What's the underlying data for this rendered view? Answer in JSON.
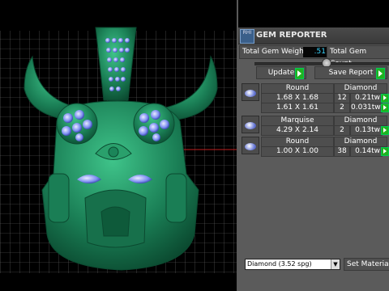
{
  "panel": {
    "title": "GEM REPORTER",
    "logo_text": "RHI",
    "total_gem_weight_label": "Total Gem Weight",
    "total_gem_weight_value": ".51",
    "total_gem_count_label": "Total Gem Count",
    "update_label": "Update",
    "save_report_label": "Save Report",
    "gems": [
      {
        "shape": "Round",
        "material": "Diamond",
        "sizes": [
          {
            "size": "1.68 X 1.68",
            "count": "12",
            "weight": "0.21tw"
          },
          {
            "size": "1.61 X 1.61",
            "count": "2",
            "weight": "0.031tw"
          }
        ]
      },
      {
        "shape": "Marquise",
        "material": "Diamond",
        "sizes": [
          {
            "size": "4.29 X 2.14",
            "count": "2",
            "weight": "0.13tw"
          }
        ]
      },
      {
        "shape": "Round",
        "material": "Diamond",
        "sizes": [
          {
            "size": "1.00 X 1.00",
            "count": "38",
            "weight": "0.14tw"
          }
        ]
      }
    ],
    "material_select": "Diamond",
    "material_select_spg": "(3.52 spg)",
    "set_material_label": "Set Material"
  },
  "colors": {
    "model": "#1f8a5e",
    "grid": "#6a6a6a",
    "gem": "#7b8cf0",
    "go_button": "#1fb31f",
    "weight_text": "#39d6ff"
  },
  "icons": {
    "go": "play-triangle-icon",
    "gem_thumb": "gem-thumbnail-icon",
    "dropdown": "chevron-down-icon"
  }
}
